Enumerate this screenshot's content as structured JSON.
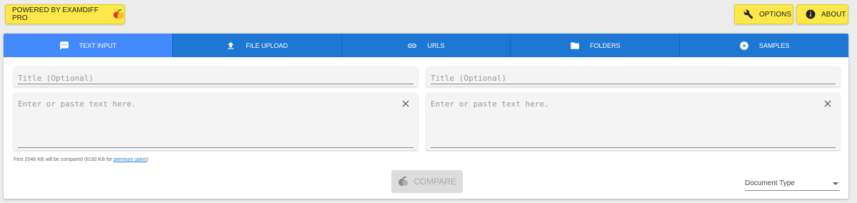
{
  "header": {
    "powered_label": "POWERED BY EXAMDIFF PRO",
    "options_label": "OPTIONS",
    "about_label": "ABOUT"
  },
  "tabs": [
    {
      "label": "TEXT INPUT",
      "icon": "text-input-icon",
      "active": true
    },
    {
      "label": "FILE UPLOAD",
      "icon": "upload-icon",
      "active": false
    },
    {
      "label": "URLS",
      "icon": "link-icon",
      "active": false
    },
    {
      "label": "FOLDERS",
      "icon": "folder-icon",
      "active": false
    },
    {
      "label": "SAMPLES",
      "icon": "play-circle-icon",
      "active": false
    }
  ],
  "left": {
    "title_placeholder": "Title (Optional)",
    "text_placeholder": "Enter or paste text here."
  },
  "right": {
    "title_placeholder": "Title (Optional)",
    "text_placeholder": "Enter or paste text here."
  },
  "note": {
    "prefix": "First 2048 KB will be compared (8192 KB for ",
    "link": "premium users",
    "suffix": ")"
  },
  "compare_label": "COMPARE",
  "document_type_label": "Document Type",
  "colors": {
    "tab_bar": "#1e78d3",
    "tab_active": "#448aff",
    "yellow_button": "#fde84a"
  }
}
